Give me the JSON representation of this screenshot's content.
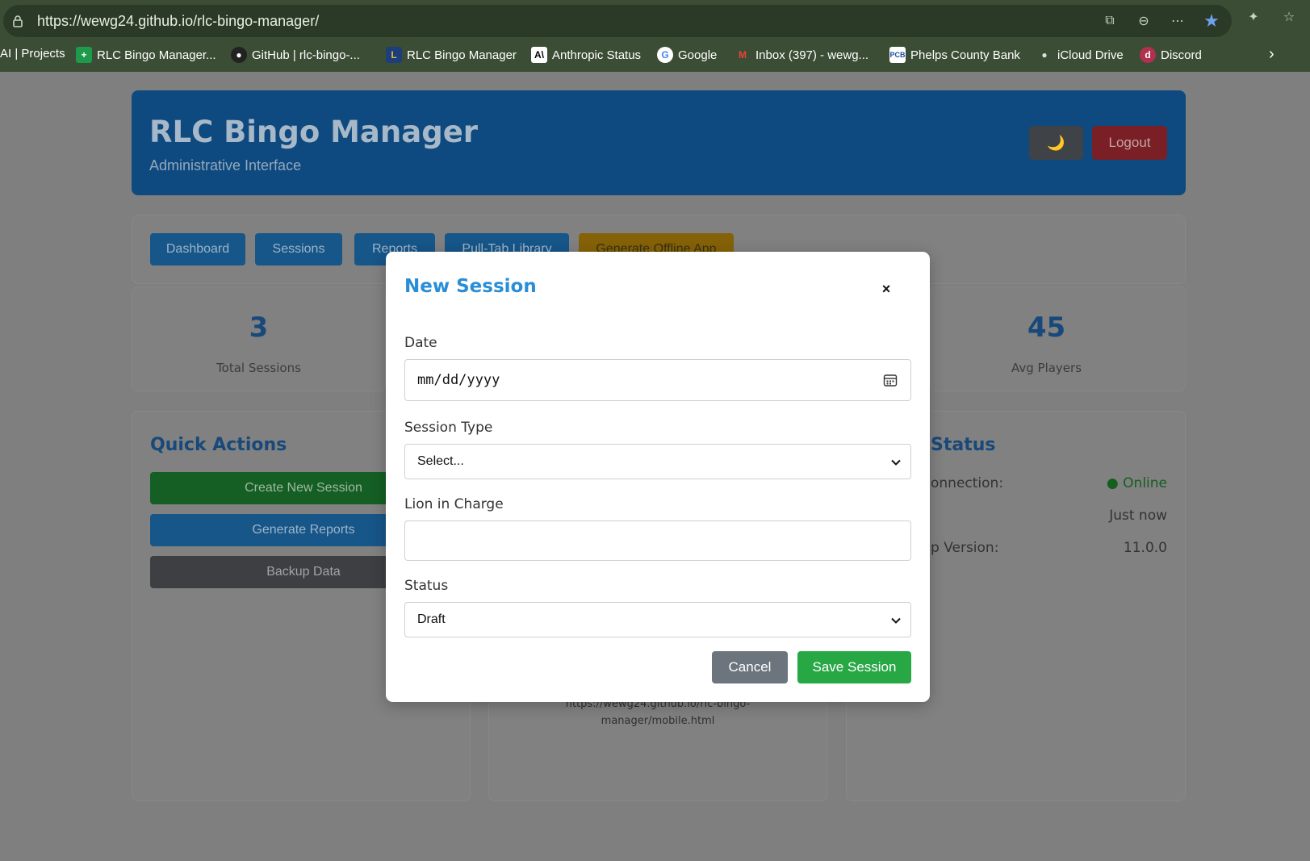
{
  "browser": {
    "url": "https://wewg24.github.io/rlc-bingo-manager/",
    "bookmarks": [
      {
        "label": "AI | Projects",
        "icon": ""
      },
      {
        "label": "RLC Bingo Manager...",
        "icon": "sheets-icon"
      },
      {
        "label": "GitHub | rlc-bingo-...",
        "icon": "github-icon"
      },
      {
        "label": "RLC Bingo Manager",
        "icon": "lions-icon"
      },
      {
        "label": "Anthropic Status",
        "icon": "anthropic-icon"
      },
      {
        "label": "Google",
        "icon": "google-icon"
      },
      {
        "label": "Inbox (397) - wewg...",
        "icon": "gmail-icon"
      },
      {
        "label": "Phelps County Bank",
        "icon": "bank-icon"
      },
      {
        "label": "iCloud Drive",
        "icon": "apple-icon"
      },
      {
        "label": "Discord",
        "icon": "discord-icon"
      }
    ]
  },
  "header": {
    "title": "RLC Bingo Manager",
    "subtitle": "Administrative Interface",
    "theme_icon": "🌙",
    "logout_label": "Logout"
  },
  "nav": {
    "dashboard": "Dashboard",
    "sessions": "Sessions",
    "reports": "Reports",
    "pulltab": "Pull-Tab Library",
    "offline": "Generate Offline App"
  },
  "stats": {
    "total_sessions_value": "3",
    "total_sessions_label": "Total Sessions",
    "avg_players_value": "45",
    "avg_players_label": "Avg Players"
  },
  "quick_actions": {
    "title": "Quick Actions",
    "create": "Create New Session",
    "reports": "Generate Reports",
    "backup": "Backup Data"
  },
  "mobile": {
    "link_line1": "https://wewg24.github.io/rlc-bingo-",
    "link_line2": "manager/mobile.html"
  },
  "status_panel": {
    "title": "Status",
    "connection_label": "onnection:",
    "connection_value": "● Online",
    "last_sync_value": "Just now",
    "version_label": "p Version:",
    "version_value": "11.0.0"
  },
  "modal": {
    "title": "New Session",
    "close": "×",
    "date_label": "Date",
    "date_placeholder": "mm/dd/yyyy",
    "session_type_label": "Session Type",
    "session_type_value": "Select...",
    "lion_label": "Lion in Charge",
    "lion_value": "",
    "status_label": "Status",
    "status_value": "Draft",
    "cancel": "Cancel",
    "save": "Save Session"
  }
}
